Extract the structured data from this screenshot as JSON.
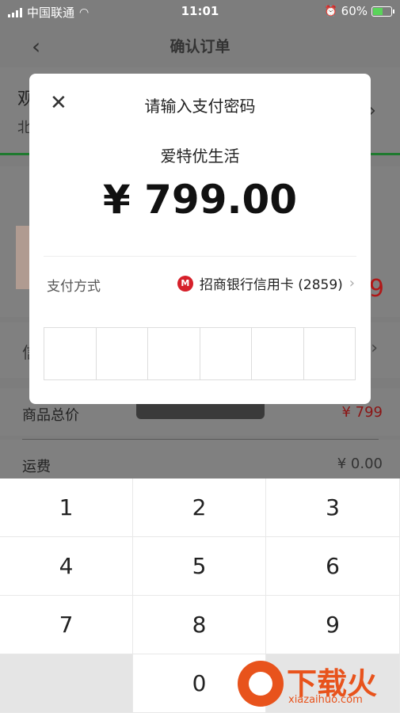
{
  "status_bar": {
    "carrier": "中国联通",
    "time": "11:01",
    "battery_percent": "60%",
    "battery_level": 0.6
  },
  "nav": {
    "title": "确认订单"
  },
  "background": {
    "address_name": "观",
    "address_city": "北",
    "product_price_partial": "9",
    "row_label_partial": "信",
    "goods_total_label": "商品总价",
    "goods_total_value": "¥ 799",
    "shipping_label": "运费",
    "shipping_value": "¥ 0.00"
  },
  "payment_modal": {
    "title": "请输入支付密码",
    "merchant": "爱特优生活",
    "amount": "¥ 799.00",
    "method_label": "支付方式",
    "method_value": "招商银行信用卡 (2859)",
    "password_length": 6
  },
  "keypad": {
    "keys": [
      "1",
      "2",
      "3",
      "4",
      "5",
      "6",
      "7",
      "8",
      "9",
      "",
      "0",
      ""
    ]
  },
  "watermark": {
    "brand": "下载火",
    "url": "xiazaihuo.com"
  },
  "colors": {
    "accent_red": "#d6202a",
    "watermark_orange": "#e8531c",
    "green_line": "#1f7a2f"
  }
}
